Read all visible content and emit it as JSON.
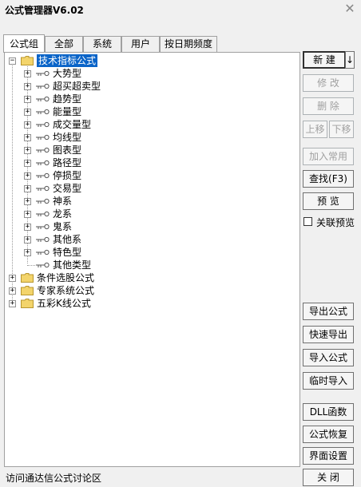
{
  "window": {
    "title": "公式管理器V6.02"
  },
  "tabs": [
    {
      "label": "公式组"
    },
    {
      "label": "全部"
    },
    {
      "label": "系统"
    },
    {
      "label": "用户"
    },
    {
      "label": "按日期频度"
    }
  ],
  "tree": {
    "root": "技术指标公式",
    "children": [
      "大势型",
      "超买超卖型",
      "趋势型",
      "能量型",
      "成交量型",
      "均线型",
      "图表型",
      "路径型",
      "停损型",
      "交易型",
      "神系",
      "龙系",
      "鬼系",
      "其他系",
      "特色型",
      "其他类型"
    ],
    "others": [
      "条件选股公式",
      "专家系统公式",
      "五彩K线公式"
    ]
  },
  "buttons": {
    "new": "新  建",
    "new_arrow": "↓",
    "modify": "修  改",
    "delete": "删  除",
    "move_up": "上移",
    "move_down": "下移",
    "add_common": "加入常用",
    "find": "查找(F3)",
    "preview": "预  览",
    "export": "导出公式",
    "quick_export": "快速导出",
    "import": "导入公式",
    "temp_import": "临时导入",
    "dll": "DLL函数",
    "restore": "公式恢复",
    "ui_settings": "界面设置",
    "close": "关  闭"
  },
  "checkbox": {
    "label": "关联预览",
    "checked": false
  },
  "status": {
    "link": "访问通达信公式讨论区"
  }
}
